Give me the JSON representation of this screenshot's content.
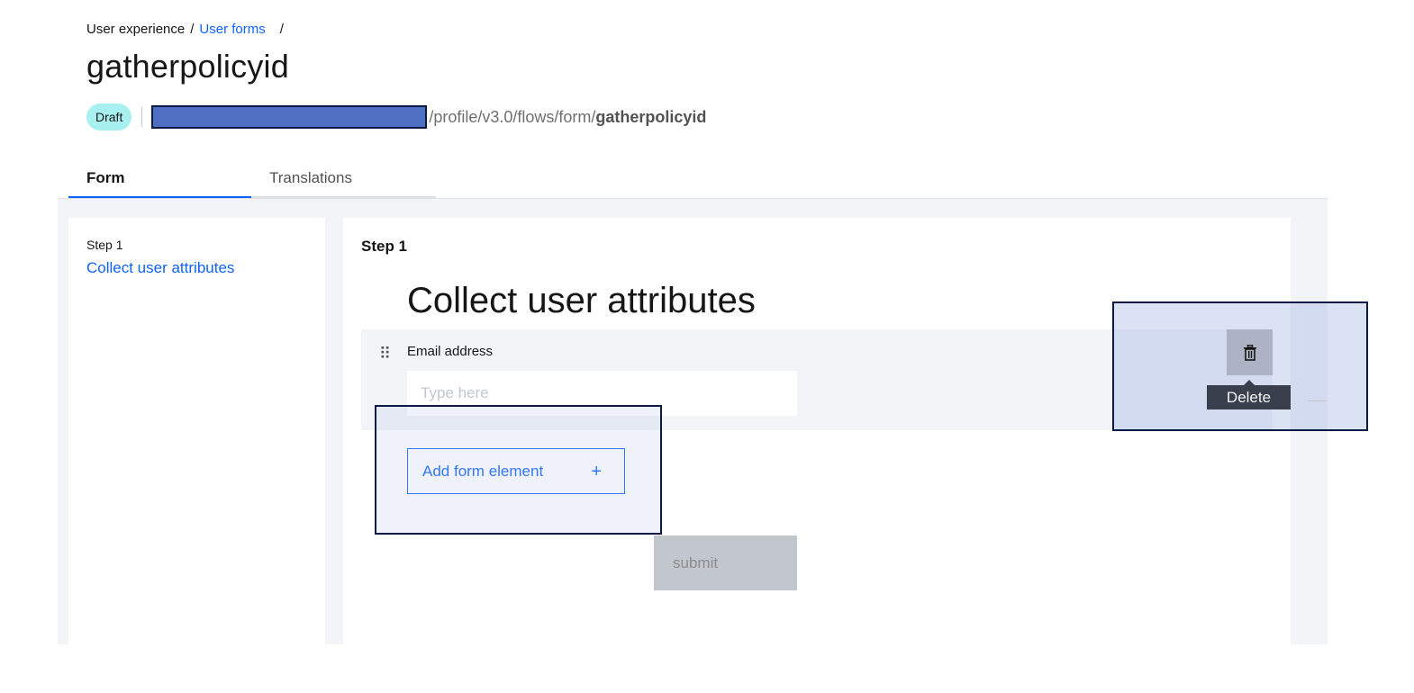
{
  "breadcrumb": {
    "root": "User experience",
    "separator": "/",
    "current": "User forms",
    "trailing_separator": "/"
  },
  "page": {
    "title": "gatherpolicyid",
    "status_badge": "Draft",
    "url_path_prefix": "/profile/v3.0/flows/form/",
    "url_path_id": "gatherpolicyid"
  },
  "tabs": [
    {
      "label": "Form",
      "active": true
    },
    {
      "label": "Translations",
      "active": false
    }
  ],
  "sidebar": {
    "step_label": "Step 1",
    "step_link": "Collect user attributes"
  },
  "editor": {
    "step_heading": "Step 1",
    "form_heading": "Collect user attributes",
    "field": {
      "label": "Email address",
      "placeholder": "Type here",
      "drag_glyph": "⠿"
    },
    "add_element_label": "Add form element",
    "add_element_icon": "+",
    "submit_label": "submit"
  },
  "actions": {
    "delete_tooltip": "Delete"
  },
  "icons": {
    "drag": "drag-handle-icon",
    "trash": "trash-icon",
    "add": "plus-icon"
  },
  "colors": {
    "accent": "#0f62fe",
    "badge_bg": "#a7f0ef",
    "tooltip_bg": "#393f4d",
    "redaction": "#4e6fc2"
  }
}
